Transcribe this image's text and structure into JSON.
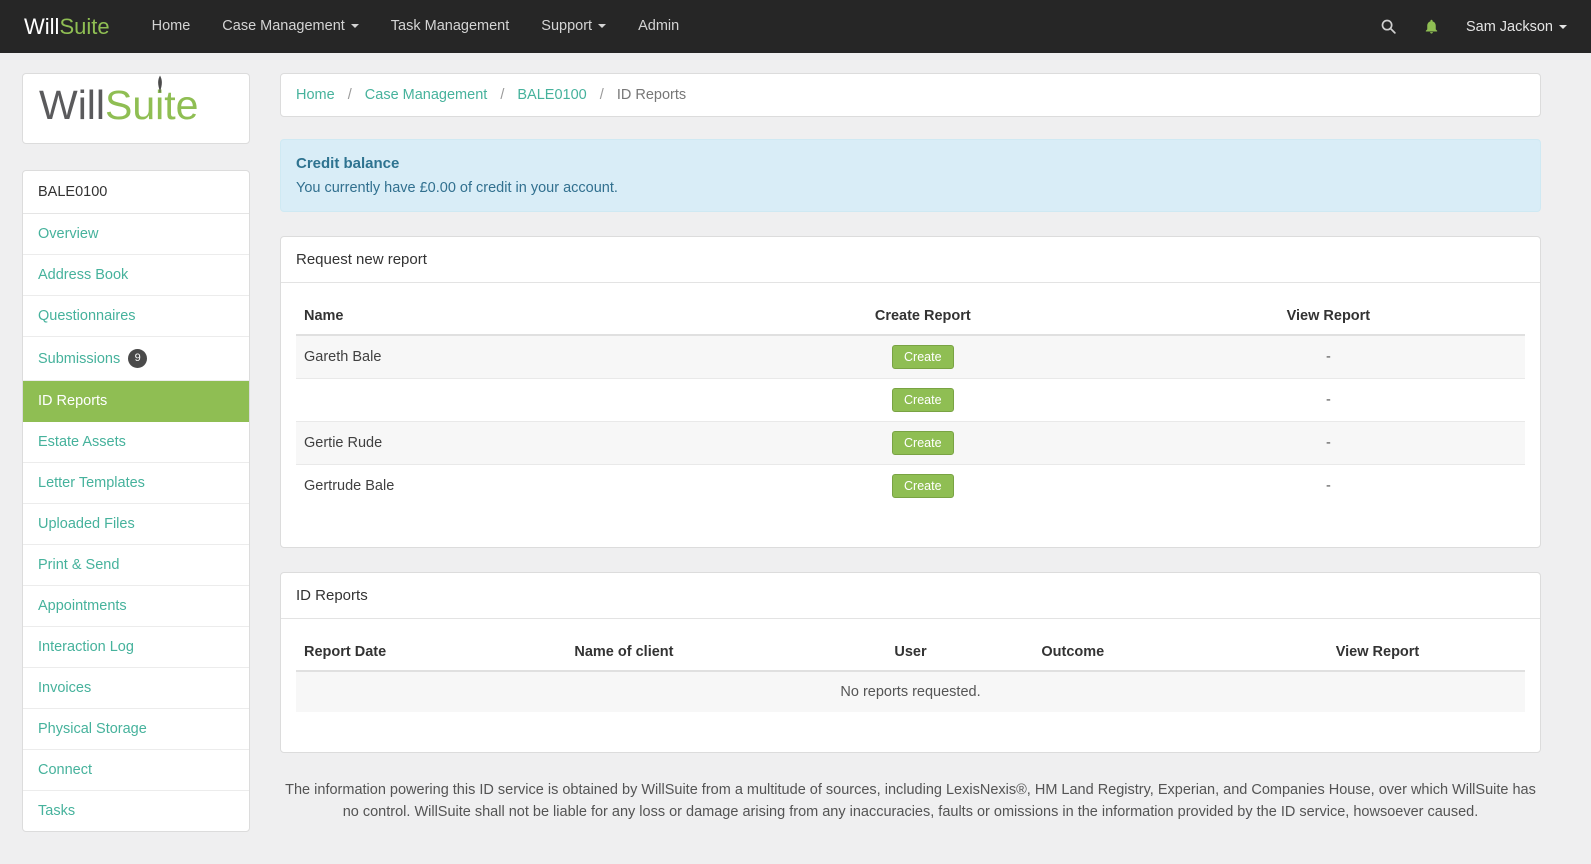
{
  "navbar": {
    "brand": {
      "part1": "Will",
      "part2": "Suite"
    },
    "items": [
      {
        "label": "Home"
      },
      {
        "label": "Case Management"
      },
      {
        "label": "Task Management"
      },
      {
        "label": "Support"
      },
      {
        "label": "Admin"
      }
    ],
    "user": {
      "name": "Sam Jackson"
    }
  },
  "sidebar": {
    "logo": {
      "part1": "Will",
      "part2": "Suite"
    },
    "case_ref": "BALE0100",
    "items": [
      {
        "label": "Overview"
      },
      {
        "label": "Address Book"
      },
      {
        "label": "Questionnaires"
      },
      {
        "label": "Submissions",
        "badge": "9"
      },
      {
        "label": "ID Reports",
        "active": true
      },
      {
        "label": "Estate Assets"
      },
      {
        "label": "Letter Templates"
      },
      {
        "label": "Uploaded Files"
      },
      {
        "label": "Print & Send"
      },
      {
        "label": "Appointments"
      },
      {
        "label": "Interaction Log"
      },
      {
        "label": "Invoices"
      },
      {
        "label": "Physical Storage"
      },
      {
        "label": "Connect"
      },
      {
        "label": "Tasks"
      }
    ]
  },
  "breadcrumb": {
    "separator": "/",
    "items": [
      {
        "label": "Home"
      },
      {
        "label": "Case Management"
      },
      {
        "label": "BALE0100"
      },
      {
        "label": "ID Reports"
      }
    ]
  },
  "alert": {
    "title": "Credit balance",
    "message": "You currently have £0.00 of credit in your account."
  },
  "request_panel": {
    "title": "Request new report",
    "columns": [
      "Name",
      "Create Report",
      "View Report"
    ],
    "rows": [
      {
        "name": "Gareth Bale",
        "create": "Create",
        "view": "-"
      },
      {
        "name": "",
        "create": "Create",
        "view": "-"
      },
      {
        "name": "Gertie Rude",
        "create": "Create",
        "view": "-"
      },
      {
        "name": "Gertrude Bale",
        "create": "Create",
        "view": "-"
      }
    ]
  },
  "reports_panel": {
    "title": "ID Reports",
    "columns": [
      "Report Date",
      "Name of client",
      "User",
      "Outcome",
      "View Report"
    ],
    "empty_message": "No reports requested."
  },
  "disclaimer": "The information powering this ID service is obtained by WillSuite from a multitude of sources, including LexisNexis®, HM Land Registry, Experian, and Companies House, over which WillSuite has no control. WillSuite shall not be liable for any loss or damage arising from any inaccuracies, faults or omissions in the information provided by the ID service, howsoever caused.",
  "colors": {
    "accent_green": "#8fbe53",
    "link_teal": "#46b29c",
    "alert_bg": "#d9edf7",
    "alert_text": "#31708f",
    "navbar_bg": "#262626",
    "badge_bg": "#4a4a4a"
  }
}
